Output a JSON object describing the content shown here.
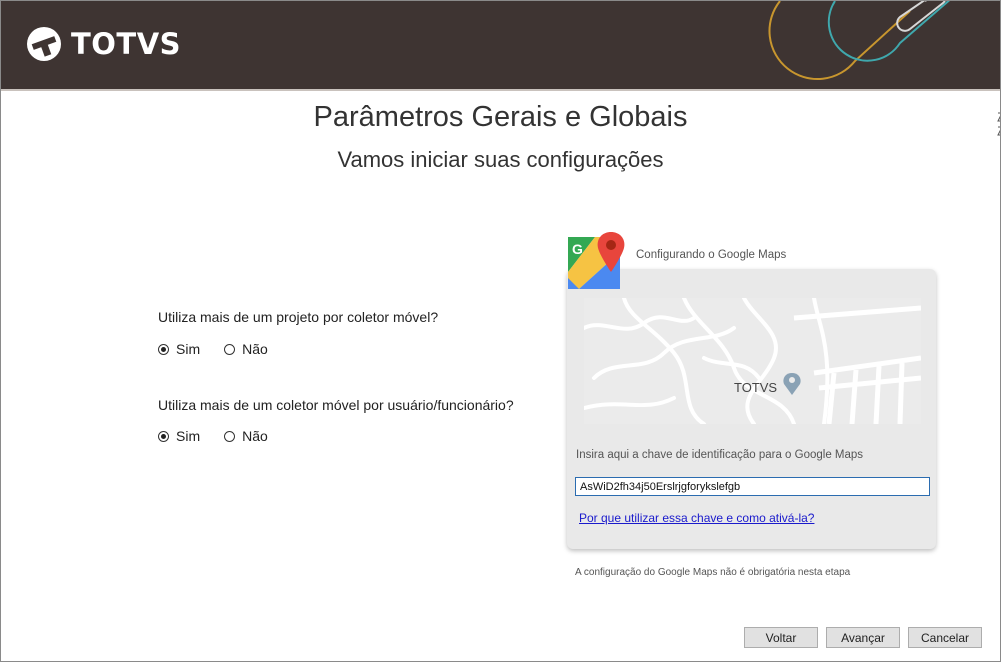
{
  "brand": {
    "name": "TOTVS",
    "header_bg": "#3e3432"
  },
  "page": {
    "title": "Parâmetros Gerais e Globais",
    "subtitle": "Vamos iniciar suas configurações"
  },
  "questions": [
    {
      "text": "Utiliza mais de um projeto por coletor móvel?",
      "options": [
        "Sim",
        "Não"
      ],
      "selected": "Sim"
    },
    {
      "text": "Utiliza mais de um coletor móvel por usuário/funcionário?",
      "options": [
        "Sim",
        "Não"
      ],
      "selected": "Sim"
    }
  ],
  "google_maps": {
    "caption": "Configurando o Google Maps",
    "icon": "google-maps-icon",
    "map_label": "TOTVS",
    "hint": "Insira aqui a chave de identificação para o Google Maps",
    "key_value": "AsWiD2fh34j50Erslrjgforykslefgb",
    "link": "Por que utilizar essa chave e como ativá-la?",
    "footnote": "A configuração do Google Maps não é obrigatória nesta etapa"
  },
  "buttons": {
    "back": "Voltar",
    "next": "Avançar",
    "cancel": "Cancelar"
  }
}
